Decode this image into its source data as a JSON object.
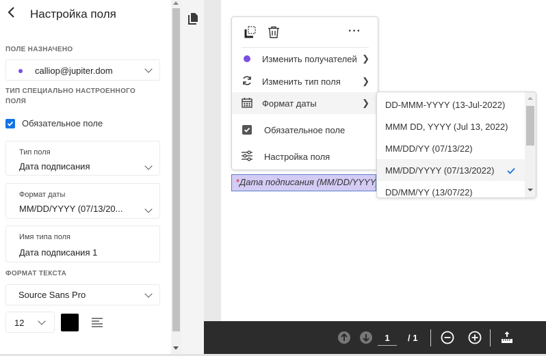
{
  "panel": {
    "title": "Настройка поля",
    "assigned_label": "ПОЛЕ НАЗНАЧЕНО",
    "assignee": "calliop@jupiter.dom",
    "assignee_color": "#7b4fe0",
    "custom_type_label": "ТИП СПЕЦИАЛЬНО НАСТРОЕННОГО ПОЛЯ",
    "required_label": "Обязательное поле",
    "required_checked": true,
    "field_type": {
      "label": "Тип поля",
      "value": "Дата подписания"
    },
    "date_format": {
      "label": "Формат даты",
      "value": "MM/DD/YYYY (07/13/20..."
    },
    "field_name": {
      "label": "Имя типа поля",
      "value": "Дата подписания 1"
    },
    "text_format_label": "ФОРМАТ ТЕКСТА",
    "font": "Source Sans Pro",
    "font_size": "12",
    "text_color": "#000000"
  },
  "context_menu": {
    "items": [
      {
        "label": "Изменить получателей",
        "icon": "recipient-dot-icon",
        "submenu": true
      },
      {
        "label": "Изменить тип поля",
        "icon": "refresh-icon",
        "submenu": true
      },
      {
        "label": "Формат даты",
        "icon": "calendar-icon",
        "submenu": true
      },
      {
        "label": "Обязательное поле",
        "icon": "checkbox-icon",
        "submenu": false
      },
      {
        "label": "Настройка поля",
        "icon": "sliders-icon",
        "submenu": false
      }
    ]
  },
  "date_submenu": {
    "options": [
      "DD-MMM-YYYY (13-Jul-2022)",
      "MMM DD, YYYY (Jul 13, 2022)",
      "MM/DD/YY (07/13/22)",
      "MM/DD/YYYY (07/13/2022)",
      "DD/MM/YY (13/07/22)"
    ],
    "selected": "MM/DD/YYYY (07/13/2022)"
  },
  "document_field": {
    "required_marker": "*",
    "text": "Дата подписания (MM/DD/YYYY)"
  },
  "toolbar": {
    "page_current": "1",
    "page_total": "/ 1"
  }
}
